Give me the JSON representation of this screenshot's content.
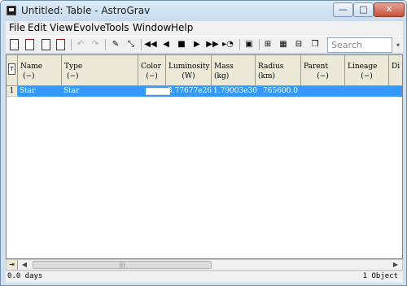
{
  "window": {
    "title": "Untitled: Table - AstroGrav",
    "min_glyph": "—",
    "max_glyph": "□",
    "close_glyph": "✕"
  },
  "menu": [
    "File",
    "Edit",
    "View",
    "Evolve",
    "Tools",
    "Window",
    "Help"
  ],
  "search": {
    "placeholder": "Search"
  },
  "table": {
    "columns": [
      {
        "name": "Name",
        "unit": "(−)"
      },
      {
        "name": "Type",
        "unit": "(−)"
      },
      {
        "name": "Color",
        "unit": "(−)"
      },
      {
        "name": "Luminosity",
        "unit": "(W)"
      },
      {
        "name": "Mass",
        "unit": "(kg)"
      },
      {
        "name": "Radius",
        "unit": "(km)"
      },
      {
        "name": "Parent",
        "unit": "(−)"
      },
      {
        "name": "Lineage",
        "unit": "(−)"
      },
      {
        "name": "Di",
        "unit": ""
      }
    ],
    "rows": [
      {
        "num": "1",
        "name": "Star",
        "type": "Star",
        "color": "#ffffff",
        "luminosity": "3.77677e26",
        "mass": "1.79003e30",
        "radius": "765600.0"
      }
    ]
  },
  "status": {
    "time": "0.0 days",
    "count": "1 Object"
  }
}
